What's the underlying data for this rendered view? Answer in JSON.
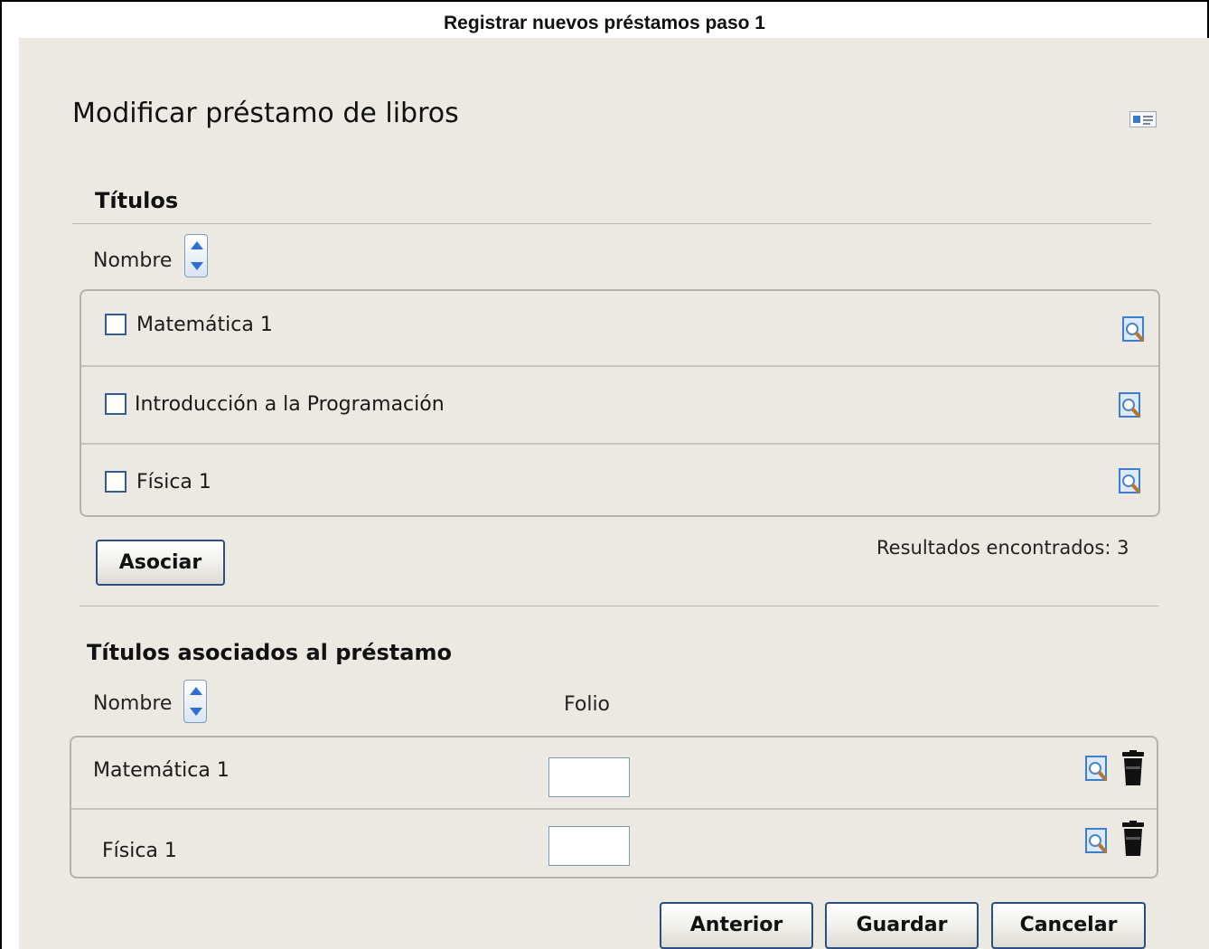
{
  "document_title": "Registrar nuevos préstamos paso 1",
  "page_title": "Modificar préstamo de libros",
  "titles_section": {
    "heading": "Títulos",
    "column_name": "Nombre",
    "items": [
      {
        "label": "Matemática 1"
      },
      {
        "label": "Introducción a la Programación"
      },
      {
        "label": "Física 1"
      }
    ],
    "associate_button": "Asociar",
    "results_text": "Resultados encontrados: 3"
  },
  "associated_section": {
    "heading": "Títulos asociados al préstamo",
    "column_name": "Nombre",
    "column_folio": "Folio",
    "rows": [
      {
        "name": "Matemática 1",
        "folio": ""
      },
      {
        "name": "Física 1",
        "folio": ""
      }
    ]
  },
  "footer": {
    "previous": "Anterior",
    "save": "Guardar",
    "cancel": "Cancelar"
  },
  "colors": {
    "panel_bg": "#ece9e3",
    "button_border": "#2b4e7e",
    "accent_blue": "#2e6fd0"
  },
  "icons": {
    "card": "id-card-icon",
    "sort": "sort-updown-icon",
    "view": "magnifier-page-icon",
    "delete": "trash-icon"
  }
}
